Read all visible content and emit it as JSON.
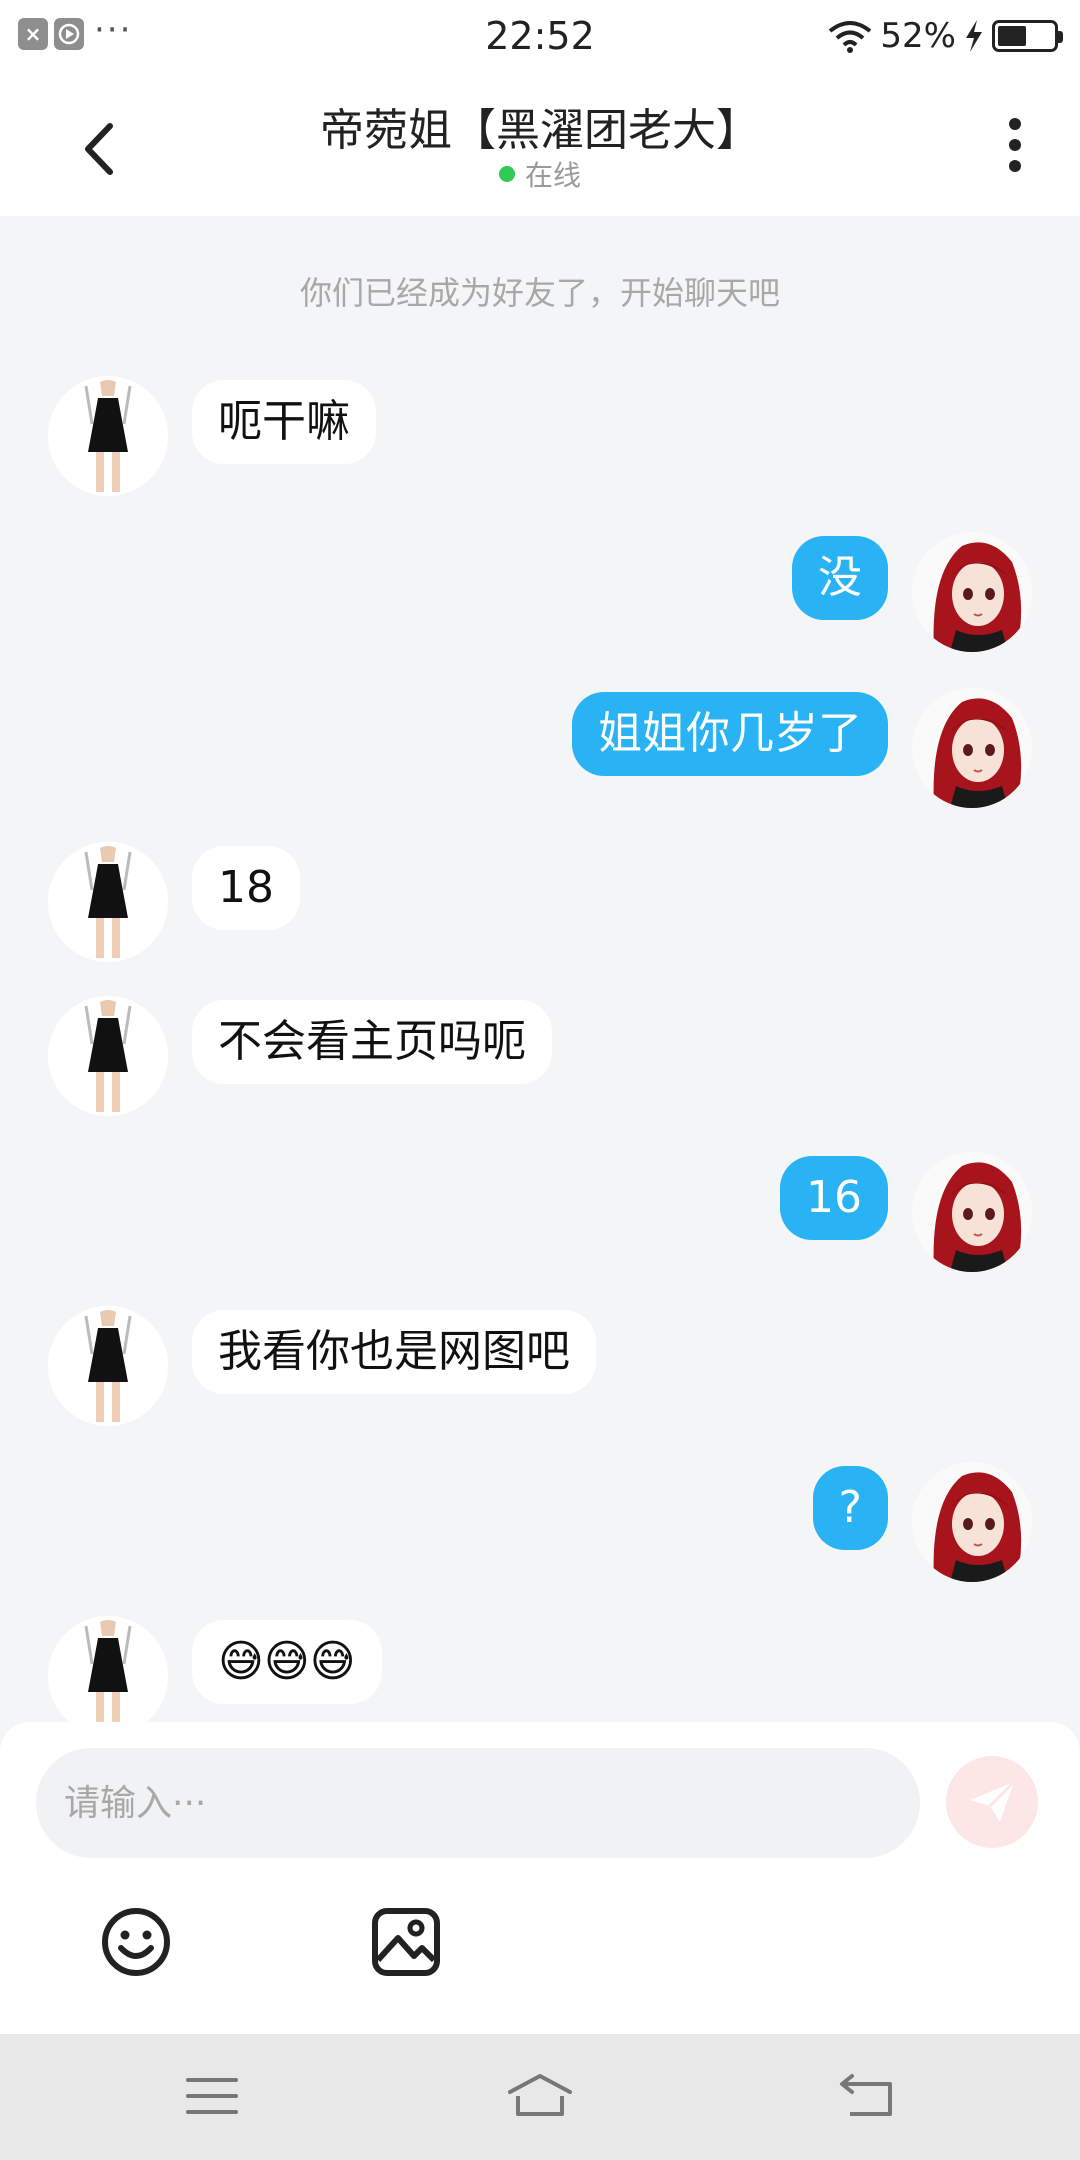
{
  "status_bar": {
    "time": "22:52",
    "battery_percent": "52%",
    "battery_level": 0.52,
    "left_icons": [
      "close-icon",
      "play-icon",
      "more-dots-icon"
    ],
    "right_icons": [
      "wifi-icon",
      "charging-bolt-icon",
      "battery-icon"
    ]
  },
  "header": {
    "title": "帝菀姐【黑濯团老大】",
    "status": "在线",
    "status_color": "#2ecc52"
  },
  "chat": {
    "system_message": "你们已经成为好友了，开始聊天吧",
    "messages": [
      {
        "side": "in",
        "text": "呃干嘛"
      },
      {
        "side": "out",
        "text": "没"
      },
      {
        "side": "out",
        "text": "姐姐你几岁了"
      },
      {
        "side": "in",
        "text": "18"
      },
      {
        "side": "in",
        "text": "不会看主页吗呃"
      },
      {
        "side": "out",
        "text": "16"
      },
      {
        "side": "in",
        "text": "我看你也是网图吧"
      },
      {
        "side": "out",
        "text": "?"
      },
      {
        "side": "in",
        "text": "😅😅😅"
      }
    ]
  },
  "composer": {
    "placeholder": "请输入···",
    "send_color": "#fde6e6",
    "tools": [
      "emoji-icon",
      "image-icon"
    ]
  },
  "colors": {
    "outgoing_bubble": "#29b3f5",
    "incoming_bubble": "#ffffff",
    "background": "#f4f5f7"
  }
}
